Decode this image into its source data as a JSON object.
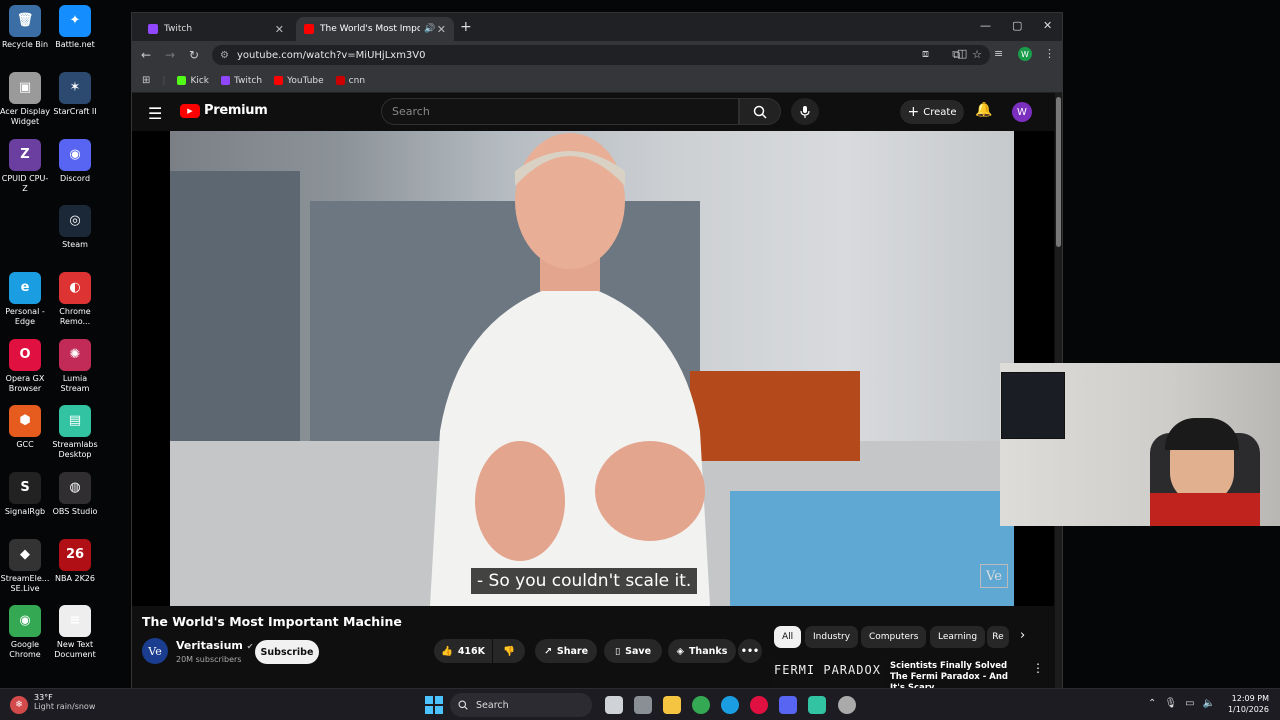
{
  "desktop": {
    "icons": [
      {
        "label": "Recycle Bin",
        "glyph": "🗑",
        "color": "#3a6ea5"
      },
      {
        "label": "Battle.net",
        "glyph": "✦",
        "color": "#148eff"
      },
      {
        "label": "Acer Display Widget",
        "glyph": "▣",
        "color": "#9a9a9a"
      },
      {
        "label": "StarCraft II",
        "glyph": "✶",
        "color": "#2c4a70"
      },
      {
        "label": "CPUID CPU-Z",
        "glyph": "Z",
        "color": "#6b3fa0"
      },
      {
        "label": "Discord",
        "glyph": "◉",
        "color": "#5865f2"
      },
      {
        "label": "Steam",
        "glyph": "◎",
        "color": "#1b2838"
      },
      {
        "label": "Personal - Edge",
        "glyph": "e",
        "color": "#1b9de2"
      },
      {
        "label": "Chrome Remo...",
        "glyph": "◐",
        "color": "#d33"
      },
      {
        "label": "Opera GX Browser",
        "glyph": "O",
        "color": "#e01141"
      },
      {
        "label": "Lumia Stream",
        "glyph": "✺",
        "color": "#c22a58"
      },
      {
        "label": "GCC",
        "glyph": "⬢",
        "color": "#e65c1e"
      },
      {
        "label": "Streamlabs Desktop",
        "glyph": "▤",
        "color": "#31c3a2"
      },
      {
        "label": "SignalRgb",
        "glyph": "S",
        "color": "#222"
      },
      {
        "label": "OBS Studio",
        "glyph": "◍",
        "color": "#302e31"
      },
      {
        "label": "StreamEle... SE.Live",
        "glyph": "◆",
        "color": "#333"
      },
      {
        "label": "NBA 2K26",
        "glyph": "26",
        "color": "#b01015"
      },
      {
        "label": "Google Chrome",
        "glyph": "◉",
        "color": "#34a853"
      },
      {
        "label": "New Text Document",
        "glyph": "≡",
        "color": "#eee"
      }
    ]
  },
  "browser": {
    "tabs": [
      {
        "title": "Twitch",
        "color": "#9146ff"
      },
      {
        "title": "The World's Most Importan",
        "color": "#ff0000"
      }
    ],
    "url": "youtube.com/watch?v=MiUHjLxm3V0",
    "bookmarks": [
      {
        "label": "Kick",
        "color": "#53fc18"
      },
      {
        "label": "Twitch",
        "color": "#9146ff"
      },
      {
        "label": "YouTube",
        "color": "#ff0000"
      },
      {
        "label": "cnn",
        "color": "#cc0000"
      }
    ],
    "profile_initial": "W"
  },
  "youtube": {
    "logo_text": "Premium",
    "search_placeholder": "Search",
    "create_label": "Create",
    "avatar_initial": "W",
    "subtitle": "- So you couldn't scale it.",
    "watermark": "Ve",
    "video_title": "The World's Most Important Machine",
    "channel": {
      "name": "Veritasium",
      "initial": "Ve",
      "subscribers": "20M subscribers"
    },
    "subscribe_label": "Subscribe",
    "like_count": "416K",
    "share_label": "Share",
    "save_label": "Save",
    "thanks_label": "Thanks",
    "chips": [
      "All",
      "Industry",
      "Computers",
      "Learning",
      "Re"
    ],
    "recommendation": {
      "thumb_text": "FERMI PARADOX",
      "title": "Scientists Finally Solved The Fermi Paradox - And It's Scary"
    }
  },
  "taskbar": {
    "weather_temp": "33°F",
    "weather_desc": "Light rain/snow",
    "search_label": "Search",
    "time": "12:09 PM",
    "date": "1/10/2026"
  }
}
